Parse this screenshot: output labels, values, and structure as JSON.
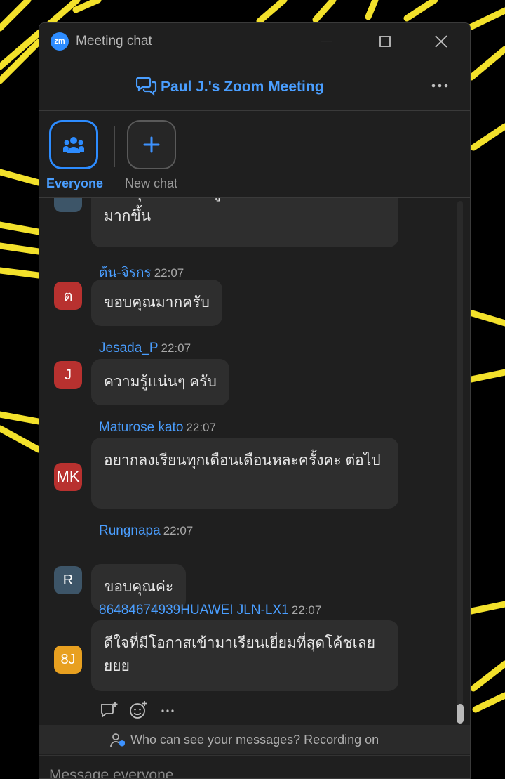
{
  "window": {
    "app_logo": "zm",
    "title": "Meeting chat"
  },
  "header": {
    "meeting_title": "Paul J.'s Zoom Meeting"
  },
  "recipients": {
    "everyone_label": "Everyone",
    "new_chat_label": "New chat"
  },
  "messages": [
    {
      "id": "m0",
      "sender": "",
      "time": "",
      "avatar": "",
      "text": "ขอบคุณ ได้ความรู้ มีแนวคิดเกี่ยวกับกราฟ มากขึ้น"
    },
    {
      "id": "m1",
      "sender": "ต้น-จิรกร",
      "time": "22:07",
      "avatar": "ต",
      "text": "ขอบคุณมากครับ"
    },
    {
      "id": "m2",
      "sender": "Jesada_P",
      "time": "22:07",
      "avatar": "J",
      "text": "ความรู้แน่นๆ ครับ"
    },
    {
      "id": "m3",
      "sender": "Maturose kato",
      "time": "22:07",
      "avatar": "MK",
      "text": "อยากลงเรียนทุกเดือนเดือนหละครั้งคะ ต่อไป"
    },
    {
      "id": "m4",
      "sender": "Rungnapa",
      "time": "22:07",
      "avatar": "R",
      "text": "ขอบคุณค่ะ"
    },
    {
      "id": "m5",
      "sender": "86484674939HUAWEI JLN-LX1",
      "time": "22:07",
      "avatar": "8J",
      "text": "ดีใจที่มีโอกาสเข้ามาเรียนเยี่ยมที่สุดโค้ชเลยยยย"
    }
  ],
  "footer": {
    "visibility_note": "Who can see your messages? Recording on"
  },
  "compose": {
    "placeholder": "Message everyone"
  },
  "colors": {
    "accent": "#2d8cff",
    "link": "#4a9eff",
    "avatar_red": "#b8312f",
    "avatar_slate": "#3d5568",
    "avatar_orange": "#e8a020"
  }
}
